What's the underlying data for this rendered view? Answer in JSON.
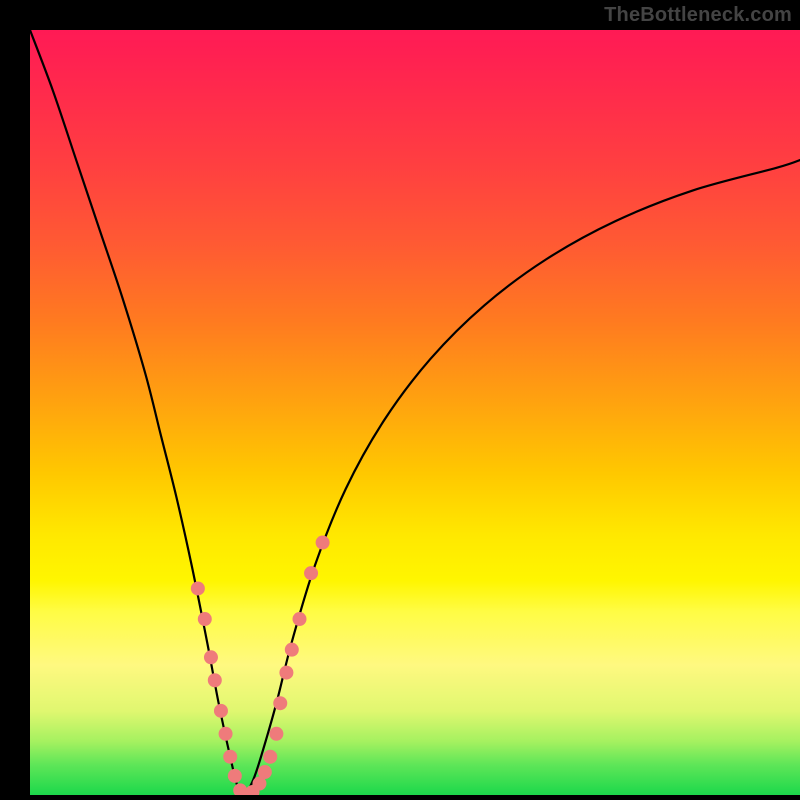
{
  "watermark": "TheBottleneck.com",
  "chart_data": {
    "type": "line",
    "title": "",
    "xlabel": "",
    "ylabel": "",
    "xlim": [
      0,
      100
    ],
    "ylim": [
      0,
      100
    ],
    "grid": false,
    "legend": false,
    "gradient_bands": [
      {
        "color": "#ff1a55",
        "stop": 0
      },
      {
        "color": "#ff4040",
        "stop": 18
      },
      {
        "color": "#ff7a20",
        "stop": 38
      },
      {
        "color": "#ffc800",
        "stop": 58
      },
      {
        "color": "#fff600",
        "stop": 72
      },
      {
        "color": "#fff980",
        "stop": 83
      },
      {
        "color": "#1cd84b",
        "stop": 100
      }
    ],
    "series": [
      {
        "name": "bottleneck-curve-left",
        "x": [
          0,
          3,
          6,
          9,
          12,
          15,
          17,
          19,
          21,
          23,
          24.5,
          26,
          27,
          28
        ],
        "y": [
          100,
          92,
          83,
          74,
          65,
          55,
          47,
          39,
          30,
          20,
          12,
          5,
          1,
          0
        ]
      },
      {
        "name": "bottleneck-curve-right",
        "x": [
          28,
          29,
          30,
          32,
          34,
          37,
          41,
          46,
          52,
          59,
          67,
          76,
          86,
          97,
          100
        ],
        "y": [
          0,
          2,
          5,
          12,
          20,
          30,
          40,
          49,
          57,
          64,
          70,
          75,
          79,
          82,
          83
        ]
      }
    ],
    "marker_series": {
      "name": "highlight-dots",
      "color": "#ef7b7b",
      "radius_px": 7,
      "points": [
        {
          "x": 21.8,
          "y": 27
        },
        {
          "x": 22.7,
          "y": 23
        },
        {
          "x": 23.5,
          "y": 18
        },
        {
          "x": 24.0,
          "y": 15
        },
        {
          "x": 24.8,
          "y": 11
        },
        {
          "x": 25.4,
          "y": 8
        },
        {
          "x": 26.0,
          "y": 5
        },
        {
          "x": 26.6,
          "y": 2.5
        },
        {
          "x": 27.3,
          "y": 0.6
        },
        {
          "x": 28.0,
          "y": 0.0
        },
        {
          "x": 28.9,
          "y": 0.4
        },
        {
          "x": 29.8,
          "y": 1.5
        },
        {
          "x": 30.5,
          "y": 3
        },
        {
          "x": 31.2,
          "y": 5
        },
        {
          "x": 32.0,
          "y": 8
        },
        {
          "x": 32.5,
          "y": 12
        },
        {
          "x": 33.3,
          "y": 16
        },
        {
          "x": 34.0,
          "y": 19
        },
        {
          "x": 35.0,
          "y": 23
        },
        {
          "x": 36.5,
          "y": 29
        },
        {
          "x": 38.0,
          "y": 33
        }
      ]
    }
  }
}
